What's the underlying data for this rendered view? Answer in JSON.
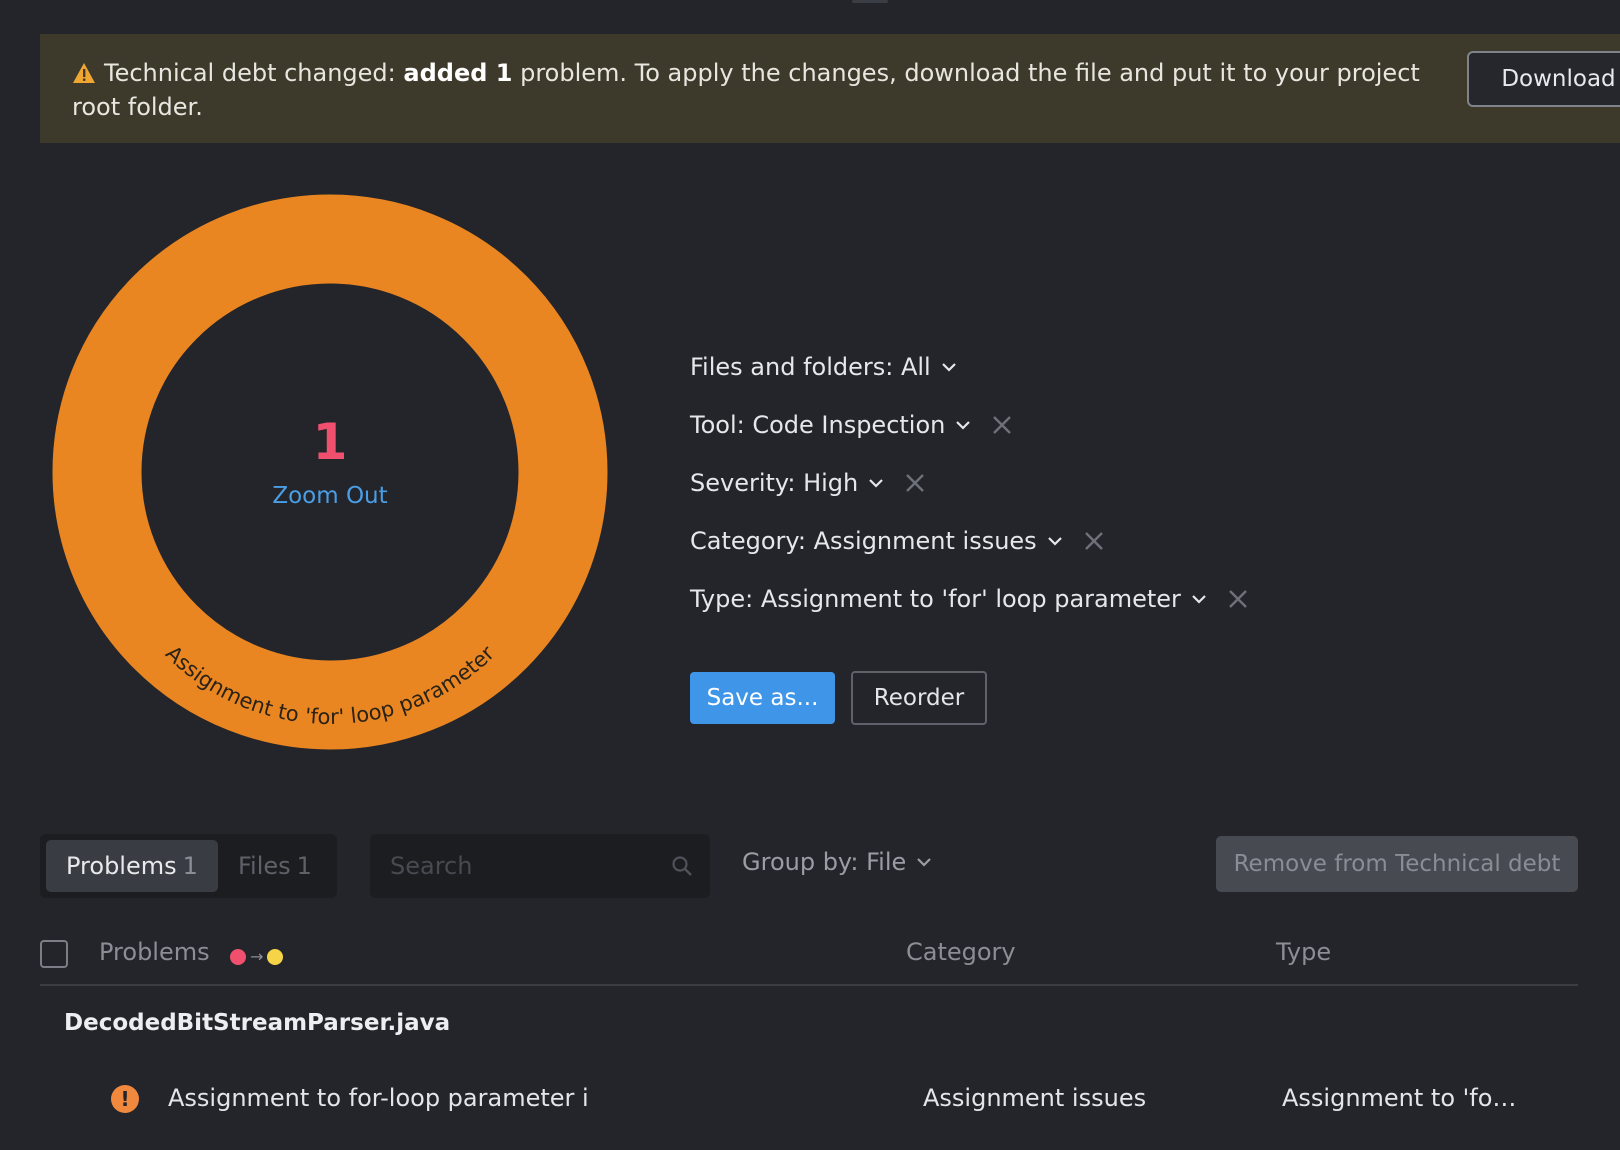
{
  "banner": {
    "prefix": "Technical debt changed: ",
    "bold": "added 1",
    "suffix": " problem. To apply the changes, download the file and put it to your project root folder.",
    "download_label": "Download",
    "icon": "warning-icon"
  },
  "donut": {
    "count": "1",
    "zoom_out_label": "Zoom Out",
    "segment_label": "Assignment to 'for' loop parameter",
    "color": "#ea8621"
  },
  "filters": [
    {
      "label": "Files and folders: All",
      "removable": false
    },
    {
      "label": "Tool: Code Inspection",
      "removable": true
    },
    {
      "label": "Severity: High",
      "removable": true
    },
    {
      "label": "Category: Assignment issues",
      "removable": true
    },
    {
      "label": "Type: Assignment to 'for' loop parameter",
      "removable": true
    }
  ],
  "actions": {
    "save_label": "Save as...",
    "reorder_label": "Reorder"
  },
  "toolbar": {
    "tab_problems": "Problems",
    "tab_problems_count": "1",
    "tab_files": "Files",
    "tab_files_count": "1",
    "search_placeholder": "Search",
    "group_by": "Group by: File",
    "remove_label": "Remove from Technical debt"
  },
  "table": {
    "col_problems": "Problems",
    "col_category": "Category",
    "col_type": "Type",
    "severity_from_color": "#f0506e",
    "severity_to_color": "#f5d547",
    "groups": [
      {
        "file": "DecodedBitStreamParser.java",
        "rows": [
          {
            "problem": "Assignment to for-loop parameter i",
            "category": "Assignment issues",
            "type": "Assignment to 'fo…"
          }
        ]
      }
    ]
  }
}
